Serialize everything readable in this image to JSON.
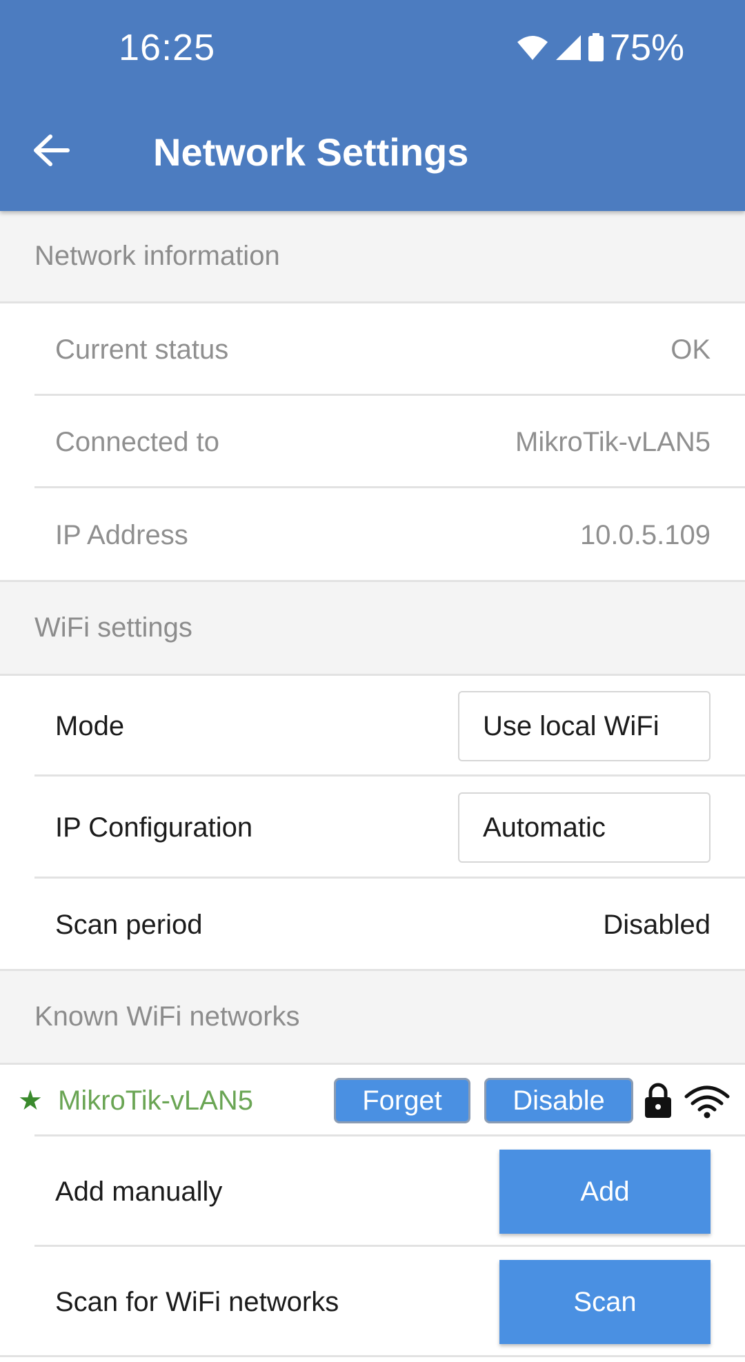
{
  "status_bar": {
    "time": "16:25",
    "battery": "75%",
    "icons": [
      "wifi-icon",
      "signal-icon",
      "battery-icon"
    ]
  },
  "app_bar": {
    "back_icon": "arrow-left-icon",
    "title": "Network Settings"
  },
  "network_information": {
    "header": "Network information",
    "rows": [
      {
        "label": "Current status",
        "value": "OK"
      },
      {
        "label": "Connected to",
        "value": "MikroTik-vLAN5"
      },
      {
        "label": "IP Address",
        "value": "10.0.5.109"
      }
    ]
  },
  "wifi_settings": {
    "header": "WiFi settings",
    "mode": {
      "label": "Mode",
      "value": "Use local WiFi"
    },
    "ip_config": {
      "label": "IP Configuration",
      "value": "Automatic"
    },
    "scan_period": {
      "label": "Scan period",
      "value": "Disabled"
    }
  },
  "known_networks": {
    "header": "Known WiFi networks",
    "networks": [
      {
        "star": "★",
        "name": "MikroTik-vLAN5",
        "forget_label": "Forget",
        "disable_label": "Disable",
        "icons": [
          "lock-icon",
          "wifi-signal-icon"
        ]
      }
    ],
    "add_manually": {
      "label": "Add manually",
      "button": "Add"
    },
    "scan": {
      "label": "Scan for WiFi networks",
      "button": "Scan"
    }
  },
  "colors": {
    "app_bar": "#4c7cc0",
    "button": "#4a90e2",
    "connected_network": "#6aa554",
    "star": "#3a8a2d"
  }
}
